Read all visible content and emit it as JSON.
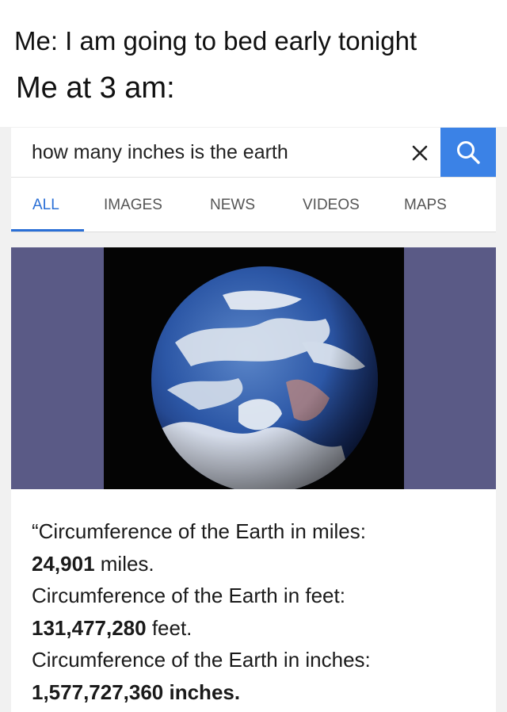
{
  "caption": {
    "line1": "Me:  I am going to bed early tonight",
    "line2": "Me at 3 am:"
  },
  "search": {
    "query": "how many inches is the earth",
    "clear_icon": "close-icon",
    "submit_icon": "search-icon",
    "accent_color": "#3b82e6"
  },
  "tabs": [
    {
      "label": "ALL",
      "active": true
    },
    {
      "label": "IMAGES",
      "active": false
    },
    {
      "label": "NEWS",
      "active": false
    },
    {
      "label": "VIDEOS",
      "active": false
    },
    {
      "label": "MAPS",
      "active": false
    }
  ],
  "result": {
    "image": "earth-image",
    "answer": [
      {
        "prefix": "“Circumference of the Earth in miles:"
      },
      {
        "value": "24,901",
        "unit": " miles."
      },
      {
        "prefix": "Circumference of the Earth in feet:"
      },
      {
        "value": "131,477,280",
        "unit": " feet."
      },
      {
        "prefix": "Circumference of the Earth in inches:"
      },
      {
        "value": "1,577,727,360 inches."
      }
    ]
  }
}
